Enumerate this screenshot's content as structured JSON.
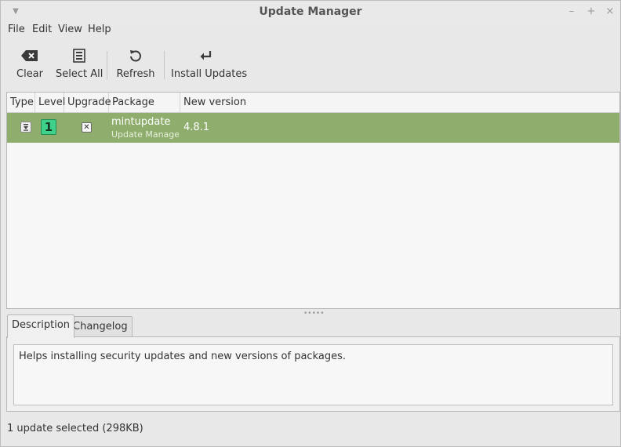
{
  "window": {
    "title": "Update Manager",
    "controls": {
      "minimize": "–",
      "maximize": "+",
      "close": "×"
    }
  },
  "menu": {
    "items": [
      "File",
      "Edit",
      "View",
      "Help"
    ]
  },
  "toolbar": {
    "clear_label": "Clear",
    "select_all_label": "Select All",
    "refresh_label": "Refresh",
    "install_label": "Install Updates"
  },
  "list": {
    "columns": [
      "Type",
      "Level",
      "Upgrade",
      "Package",
      "New version"
    ],
    "rows": [
      {
        "type_icon": "package-download-icon",
        "level": "1",
        "upgrade_checked": true,
        "package": "mintupdate",
        "description": "Update Manager.",
        "new_version": "4.8.1",
        "row_color": "#8fad6c",
        "level_color": "#3fd18a"
      }
    ]
  },
  "tabs": {
    "description_label": "Description",
    "changelog_label": "Changelog",
    "active": "Description"
  },
  "details": {
    "description_text": "Helps installing security updates and new versions of packages."
  },
  "status": {
    "text": "1 update selected (298KB)"
  }
}
